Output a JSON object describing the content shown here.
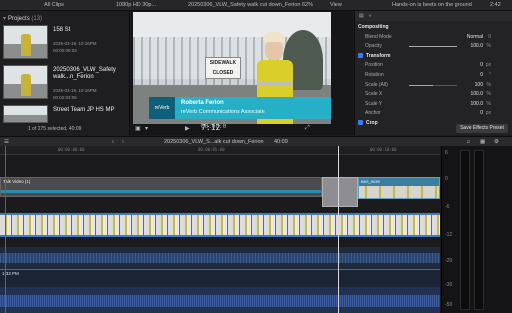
{
  "topbar": {
    "all_clips": "All Clips",
    "format": "1080p HD 30p...",
    "title": "20250306_VLW_Safety walk cut down_Ferion",
    "zoom": "62%",
    "view": "View",
    "hint": "Hands-on is beets on the ground",
    "duration": "2:42"
  },
  "browser": {
    "header_label": "Projects",
    "header_count": "(13)",
    "clips": [
      {
        "title": "158 St",
        "date": "2025-03-19, 10:16PM",
        "duration": "00:00:09:03"
      },
      {
        "title": "20250306_VLW_Safety walk...n_Ferion",
        "date": "2025-03-19, 10:16PM",
        "duration": "00:02:03:06"
      },
      {
        "title": "Street Team JP HS MP",
        "date": "",
        "duration": ""
      }
    ],
    "footer": "1 of 275 selected, 40:09"
  },
  "viewer": {
    "sign_text": "SIDEWALK CLOSED",
    "lower_third": {
      "logo": "reVerb",
      "name": "Roberta Ferion",
      "role": "reVerb Communications Associate"
    },
    "timecode_dim": "00:00:0",
    "timecode_main": "7:12"
  },
  "inspector": {
    "rows": [
      {
        "label": "Compositing",
        "type": "section"
      },
      {
        "label": "Blend Mode",
        "value": "Normal",
        "unit": "0"
      },
      {
        "label": "Opacity",
        "value": "100.0",
        "unit": "%",
        "slider": 1.0
      },
      {
        "label": "Transform",
        "type": "section-cb"
      },
      {
        "label": "Position",
        "value": "0",
        "unit": "px"
      },
      {
        "label": "Rotation",
        "value": "0",
        "unit": "°"
      },
      {
        "label": "Scale (All)",
        "value": "100",
        "unit": "%",
        "slider": 0.5
      },
      {
        "label": "Scale X",
        "value": "100.0",
        "unit": "%"
      },
      {
        "label": "Scale Y",
        "value": "100.0",
        "unit": "%"
      },
      {
        "label": "Anchor",
        "value": "0",
        "unit": "px"
      },
      {
        "label": "Crop",
        "type": "section-cb"
      }
    ],
    "save_button": "Save Effects Preset"
  },
  "timeline": {
    "project_title": "20250306_VLW_S...alk cut down_Ferion",
    "project_duration": "40:09",
    "ruler_ticks": [
      "00:00:00:00",
      "00:00:05:00",
      "00:00:10:00"
    ],
    "title_clip": "Talk Video (1)",
    "right_clip": "IMG_0039",
    "audio_clip": "1:33 PM"
  },
  "meters": {
    "labels": [
      "6",
      "0",
      "-6",
      "-12",
      "-20",
      "-30",
      "-50"
    ]
  }
}
